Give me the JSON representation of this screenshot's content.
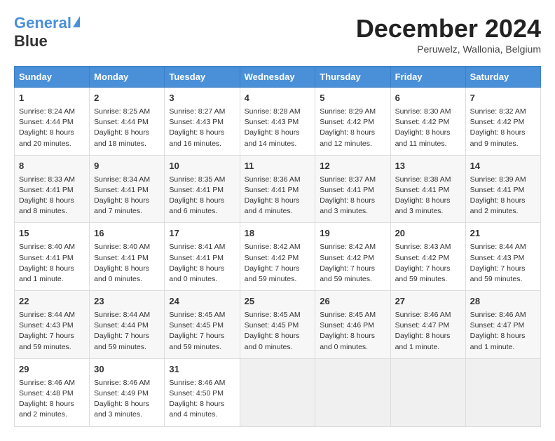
{
  "header": {
    "logo_line1": "General",
    "logo_line2": "Blue",
    "month": "December 2024",
    "location": "Peruwelz, Wallonia, Belgium"
  },
  "weekdays": [
    "Sunday",
    "Monday",
    "Tuesday",
    "Wednesday",
    "Thursday",
    "Friday",
    "Saturday"
  ],
  "weeks": [
    [
      {
        "day": "1",
        "lines": [
          "Sunrise: 8:24 AM",
          "Sunset: 4:44 PM",
          "Daylight: 8 hours",
          "and 20 minutes."
        ]
      },
      {
        "day": "2",
        "lines": [
          "Sunrise: 8:25 AM",
          "Sunset: 4:44 PM",
          "Daylight: 8 hours",
          "and 18 minutes."
        ]
      },
      {
        "day": "3",
        "lines": [
          "Sunrise: 8:27 AM",
          "Sunset: 4:43 PM",
          "Daylight: 8 hours",
          "and 16 minutes."
        ]
      },
      {
        "day": "4",
        "lines": [
          "Sunrise: 8:28 AM",
          "Sunset: 4:43 PM",
          "Daylight: 8 hours",
          "and 14 minutes."
        ]
      },
      {
        "day": "5",
        "lines": [
          "Sunrise: 8:29 AM",
          "Sunset: 4:42 PM",
          "Daylight: 8 hours",
          "and 12 minutes."
        ]
      },
      {
        "day": "6",
        "lines": [
          "Sunrise: 8:30 AM",
          "Sunset: 4:42 PM",
          "Daylight: 8 hours",
          "and 11 minutes."
        ]
      },
      {
        "day": "7",
        "lines": [
          "Sunrise: 8:32 AM",
          "Sunset: 4:42 PM",
          "Daylight: 8 hours",
          "and 9 minutes."
        ]
      }
    ],
    [
      {
        "day": "8",
        "lines": [
          "Sunrise: 8:33 AM",
          "Sunset: 4:41 PM",
          "Daylight: 8 hours",
          "and 8 minutes."
        ]
      },
      {
        "day": "9",
        "lines": [
          "Sunrise: 8:34 AM",
          "Sunset: 4:41 PM",
          "Daylight: 8 hours",
          "and 7 minutes."
        ]
      },
      {
        "day": "10",
        "lines": [
          "Sunrise: 8:35 AM",
          "Sunset: 4:41 PM",
          "Daylight: 8 hours",
          "and 6 minutes."
        ]
      },
      {
        "day": "11",
        "lines": [
          "Sunrise: 8:36 AM",
          "Sunset: 4:41 PM",
          "Daylight: 8 hours",
          "and 4 minutes."
        ]
      },
      {
        "day": "12",
        "lines": [
          "Sunrise: 8:37 AM",
          "Sunset: 4:41 PM",
          "Daylight: 8 hours",
          "and 3 minutes."
        ]
      },
      {
        "day": "13",
        "lines": [
          "Sunrise: 8:38 AM",
          "Sunset: 4:41 PM",
          "Daylight: 8 hours",
          "and 3 minutes."
        ]
      },
      {
        "day": "14",
        "lines": [
          "Sunrise: 8:39 AM",
          "Sunset: 4:41 PM",
          "Daylight: 8 hours",
          "and 2 minutes."
        ]
      }
    ],
    [
      {
        "day": "15",
        "lines": [
          "Sunrise: 8:40 AM",
          "Sunset: 4:41 PM",
          "Daylight: 8 hours",
          "and 1 minute."
        ]
      },
      {
        "day": "16",
        "lines": [
          "Sunrise: 8:40 AM",
          "Sunset: 4:41 PM",
          "Daylight: 8 hours",
          "and 0 minutes."
        ]
      },
      {
        "day": "17",
        "lines": [
          "Sunrise: 8:41 AM",
          "Sunset: 4:41 PM",
          "Daylight: 8 hours",
          "and 0 minutes."
        ]
      },
      {
        "day": "18",
        "lines": [
          "Sunrise: 8:42 AM",
          "Sunset: 4:42 PM",
          "Daylight: 7 hours",
          "and 59 minutes."
        ]
      },
      {
        "day": "19",
        "lines": [
          "Sunrise: 8:42 AM",
          "Sunset: 4:42 PM",
          "Daylight: 7 hours",
          "and 59 minutes."
        ]
      },
      {
        "day": "20",
        "lines": [
          "Sunrise: 8:43 AM",
          "Sunset: 4:42 PM",
          "Daylight: 7 hours",
          "and 59 minutes."
        ]
      },
      {
        "day": "21",
        "lines": [
          "Sunrise: 8:44 AM",
          "Sunset: 4:43 PM",
          "Daylight: 7 hours",
          "and 59 minutes."
        ]
      }
    ],
    [
      {
        "day": "22",
        "lines": [
          "Sunrise: 8:44 AM",
          "Sunset: 4:43 PM",
          "Daylight: 7 hours",
          "and 59 minutes."
        ]
      },
      {
        "day": "23",
        "lines": [
          "Sunrise: 8:44 AM",
          "Sunset: 4:44 PM",
          "Daylight: 7 hours",
          "and 59 minutes."
        ]
      },
      {
        "day": "24",
        "lines": [
          "Sunrise: 8:45 AM",
          "Sunset: 4:45 PM",
          "Daylight: 7 hours",
          "and 59 minutes."
        ]
      },
      {
        "day": "25",
        "lines": [
          "Sunrise: 8:45 AM",
          "Sunset: 4:45 PM",
          "Daylight: 8 hours",
          "and 0 minutes."
        ]
      },
      {
        "day": "26",
        "lines": [
          "Sunrise: 8:45 AM",
          "Sunset: 4:46 PM",
          "Daylight: 8 hours",
          "and 0 minutes."
        ]
      },
      {
        "day": "27",
        "lines": [
          "Sunrise: 8:46 AM",
          "Sunset: 4:47 PM",
          "Daylight: 8 hours",
          "and 1 minute."
        ]
      },
      {
        "day": "28",
        "lines": [
          "Sunrise: 8:46 AM",
          "Sunset: 4:47 PM",
          "Daylight: 8 hours",
          "and 1 minute."
        ]
      }
    ],
    [
      {
        "day": "29",
        "lines": [
          "Sunrise: 8:46 AM",
          "Sunset: 4:48 PM",
          "Daylight: 8 hours",
          "and 2 minutes."
        ]
      },
      {
        "day": "30",
        "lines": [
          "Sunrise: 8:46 AM",
          "Sunset: 4:49 PM",
          "Daylight: 8 hours",
          "and 3 minutes."
        ]
      },
      {
        "day": "31",
        "lines": [
          "Sunrise: 8:46 AM",
          "Sunset: 4:50 PM",
          "Daylight: 8 hours",
          "and 4 minutes."
        ]
      },
      null,
      null,
      null,
      null
    ]
  ]
}
